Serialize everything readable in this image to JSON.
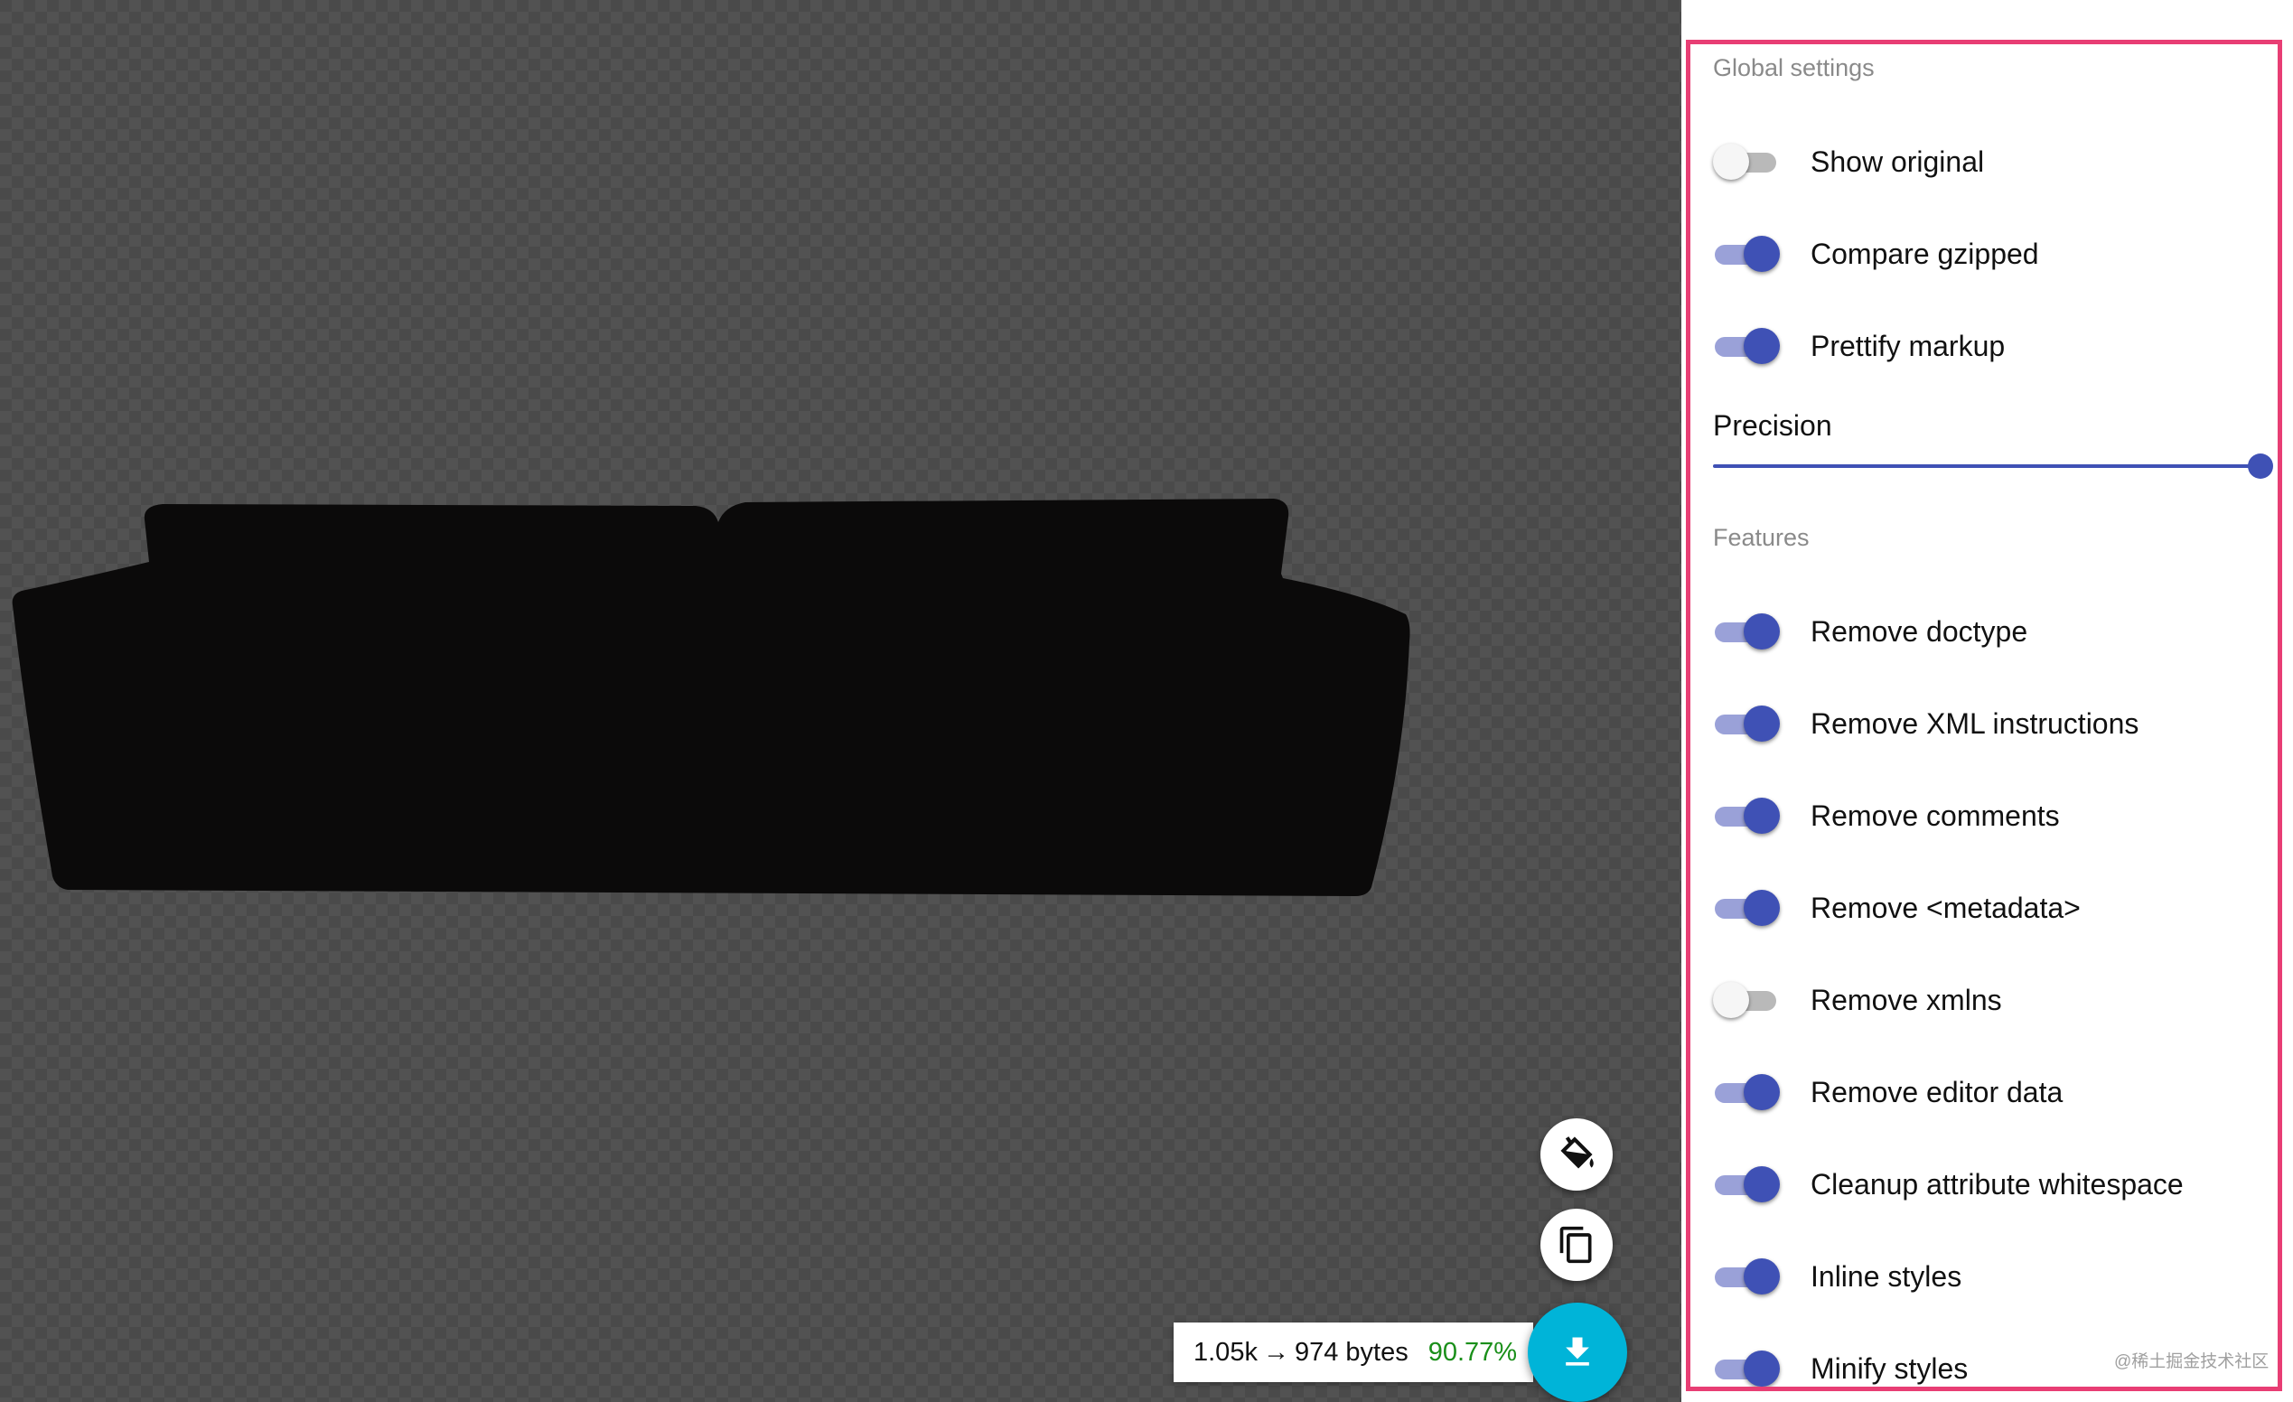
{
  "results": {
    "original_size": "1.05k",
    "arrow": "→",
    "optimized_size": "974 bytes",
    "percent": "90.77%"
  },
  "actions": {
    "paint_icon": "paint-bucket-icon",
    "copy_icon": "copy-icon",
    "download_icon": "download-icon",
    "download_color": "#00b4d8"
  },
  "global_settings": {
    "title": "Global settings",
    "items": [
      {
        "label": "Show original",
        "on": false
      },
      {
        "label": "Compare gzipped",
        "on": true
      },
      {
        "label": "Prettify markup",
        "on": true
      }
    ],
    "precision": {
      "label": "Precision",
      "value_fraction": 1.0
    }
  },
  "features": {
    "title": "Features",
    "items": [
      {
        "label": "Remove doctype",
        "on": true
      },
      {
        "label": "Remove XML instructions",
        "on": true
      },
      {
        "label": "Remove comments",
        "on": true
      },
      {
        "label": "Remove <metadata>",
        "on": true
      },
      {
        "label": "Remove xmlns",
        "on": false
      },
      {
        "label": "Remove editor data",
        "on": true
      },
      {
        "label": "Cleanup attribute whitespace",
        "on": true
      },
      {
        "label": "Inline styles",
        "on": true
      },
      {
        "label": "Minify styles",
        "on": true
      }
    ]
  },
  "watermark": "@稀土掘金技术社区",
  "colors": {
    "accent": "#3f51b5",
    "accent_track": "#9aa1d8",
    "panel_outline": "#e83e74",
    "savings": "#1a8f1a"
  }
}
